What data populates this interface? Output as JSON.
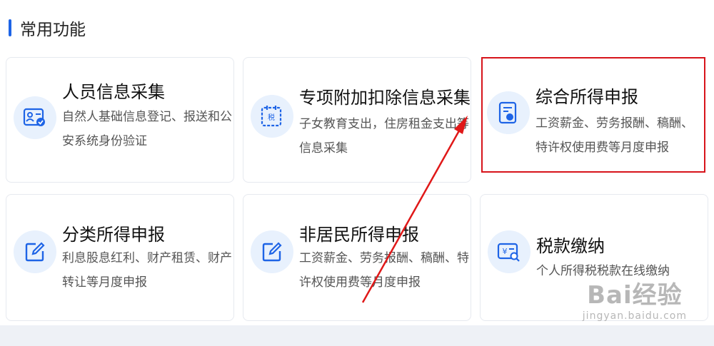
{
  "section": {
    "title": "常用功能"
  },
  "cards": [
    {
      "title": "人员信息采集",
      "desc": "自然人基础信息登记、报送和公安系统身份验证",
      "icon": "id-card-icon"
    },
    {
      "title": "专项附加扣除信息采集",
      "desc": "子女教育支出，住房租金支出等信息采集",
      "icon": "tax-calendar-icon"
    },
    {
      "title": "综合所得申报",
      "desc": "工资薪金、劳务报酬、稿酬、特许权使用费等月度申报",
      "icon": "tax-document-icon"
    },
    {
      "title": "分类所得申报",
      "desc": "利息股息红利、财产租赁、财产转让等月度申报",
      "icon": "edit-icon"
    },
    {
      "title": "非居民所得申报",
      "desc": "工资薪金、劳务报酬、稿酬、特许权使用费等月度申报",
      "icon": "edit-icon"
    },
    {
      "title": "税款缴纳",
      "desc": "个人所得税税款在线缴纳",
      "icon": "payment-search-icon"
    }
  ],
  "watermark": {
    "logo": "Bai经验",
    "url": "jingyan.baidu.com"
  },
  "colors": {
    "accent": "#1e64e6",
    "highlight": "#d7141b",
    "icon_bg": "#e8f1fd"
  }
}
